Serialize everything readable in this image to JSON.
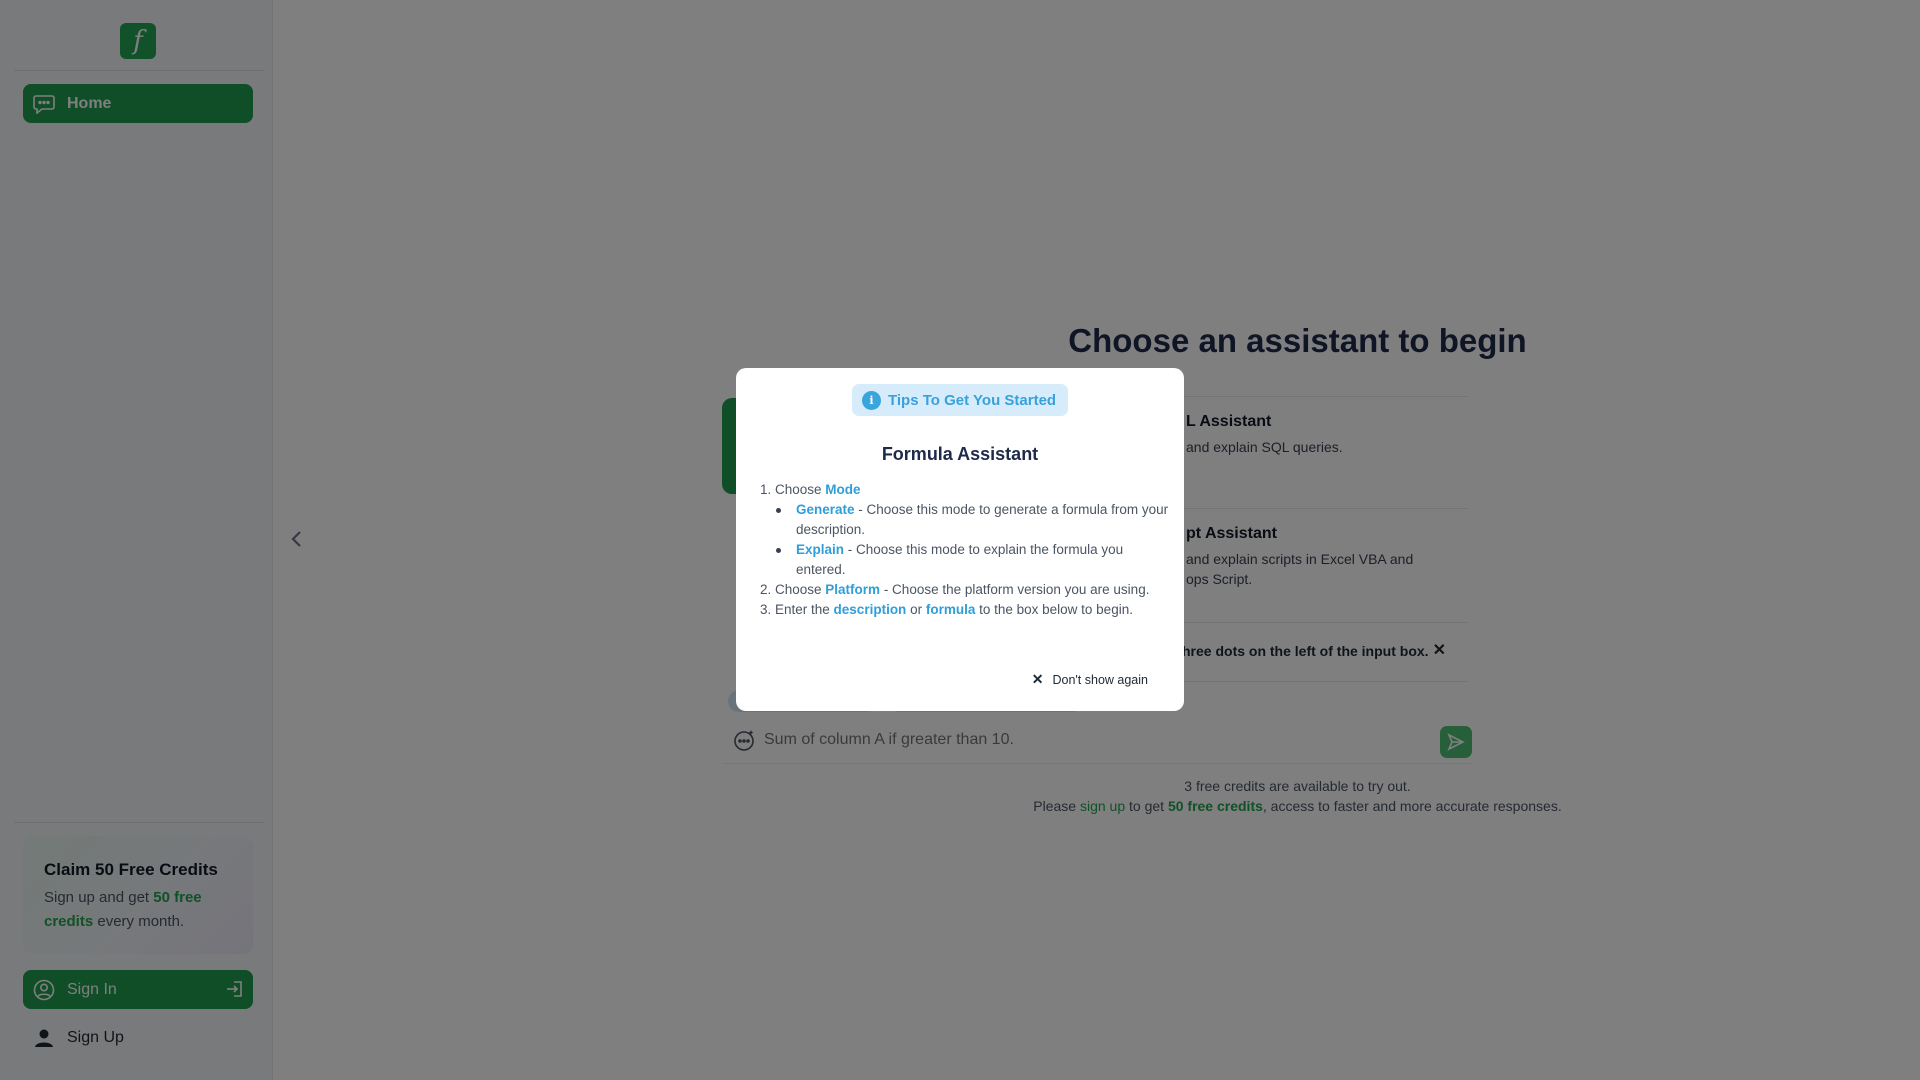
{
  "sidebar": {
    "logo_glyph": "f",
    "nav": [
      {
        "label": "Home",
        "icon": "chat-icon"
      }
    ],
    "promo": {
      "title": "Claim 50 Free Credits",
      "text_prefix": "Sign up and get ",
      "text_highlight": "50 free credits",
      "text_suffix": " every month."
    },
    "sign_in_label": "Sign In",
    "sign_up_label": "Sign Up"
  },
  "main": {
    "title": "Choose an assistant to begin",
    "cards": [
      {
        "title": "L Assistant",
        "desc": "and explain SQL queries."
      },
      {
        "title": "pt Assistant",
        "desc": "and explain scripts in Excel VBA and\nops Script."
      }
    ],
    "hint": "hree dots on the left of the input box.",
    "hint_close": "✕",
    "input_placeholder": "Sum of column A if greater than 10.",
    "credits_line1": "3 free credits are available to try out.",
    "credits_line2": {
      "prefix": "Please ",
      "link": "sign up",
      "middle": " to get ",
      "bold": "50 free credits",
      "suffix": ", access to faster and more accurate responses."
    }
  },
  "modal": {
    "badge": "Tips To Get You Started",
    "badge_icon_glyph": "i",
    "title": "Formula Assistant",
    "step1": {
      "prefix": "1. Choose ",
      "kw": "Mode"
    },
    "bullets": [
      {
        "kw": "Generate",
        "text": " - Choose this mode to generate a formula from your description."
      },
      {
        "kw": "Explain",
        "text": " - Choose this mode to explain the formula you entered."
      }
    ],
    "step2": {
      "prefix": "2. Choose ",
      "kw": "Platform",
      "suffix": " - Choose the platform version you are using."
    },
    "step3": {
      "prefix": "3. Enter the ",
      "kw1": "description",
      "mid": " or ",
      "kw2": "formula",
      "suffix": " to the box below to begin."
    },
    "dont_show_label": "Don't show again",
    "dont_show_glyph": "✕"
  },
  "colors": {
    "brand_green": "#1f9d4f",
    "accent_blue": "#2f9ed9",
    "overlay": "rgba(0,0,0,0.5)"
  }
}
